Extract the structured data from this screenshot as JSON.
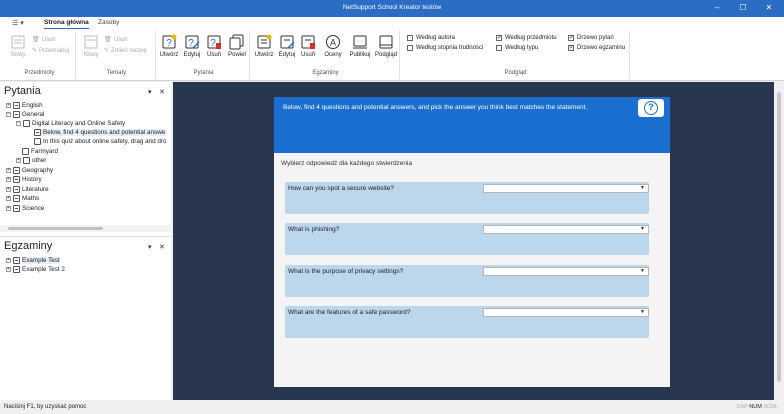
{
  "window": {
    "title": "NetSupport School Kreator testów"
  },
  "ribbon_tabs": {
    "qa": "☰ ▾",
    "main": "Strona główna",
    "res": "Zasoby"
  },
  "ribbon": {
    "przedmioty": {
      "label": "Przedmioty",
      "nowy": "Nowy",
      "usun": "Usuń",
      "przemianuj": "Przemianuj"
    },
    "tematy": {
      "label": "Tematy",
      "nowy": "Nowy",
      "usun": "Usuń",
      "zmien": "Zmień nazwę"
    },
    "pytania": {
      "label": "Pytania",
      "utworz": "Utwórz",
      "edytuj": "Edytuj",
      "usun": "Usuń",
      "powiel": "Powiel"
    },
    "egzaminy": {
      "label": "Egzaminy",
      "utworz": "Utwórz",
      "edytuj": "Edytuj",
      "usun": "Usuń",
      "oceny": "Oceny",
      "publikuj": "Publikuj",
      "podglad": "Podgląd"
    },
    "podglad": {
      "label": "Podgląd",
      "wg_autora": "Według autora",
      "wg_stopnia": "Według stopnia trudności",
      "wg_przedmiotu": "Według przedmiotu",
      "wg_typu": "Według typu",
      "drzewo_pytan": "Drzewo pytań",
      "drzewo_egz": "Drzewo egzaminu"
    }
  },
  "pytania_panel": {
    "title": "Pytania",
    "tree": {
      "english": "English",
      "general": "General",
      "digital": "Digital Literacy and Online Safety",
      "q1": "Below, find 4 questions and potential answe",
      "q2": "In this quiz about online safety, drag and dro",
      "farmyard": "Farmyard",
      "other": "other",
      "geography": "Geography",
      "history": "History",
      "literature": "Literature",
      "maths": "Maths",
      "science": "Science"
    }
  },
  "egzaminy_panel": {
    "title": "Egzaminy",
    "items": {
      "t1": "Example Test",
      "t2": "Example Test 2"
    }
  },
  "question": {
    "header": "Below, find 4 questions and potential answers, and pick the answer you think best matches the statement.",
    "instruction": "Wybierz odpowiedź dla każdego stwierdzenia",
    "items": [
      {
        "label": "How can you spot a secure website?",
        "value": ""
      },
      {
        "label": "What is phishing?",
        "value": ""
      },
      {
        "label": "What is the purpose of privacy settings?",
        "value": ""
      },
      {
        "label": "What are the features of a safe password?",
        "value": ""
      }
    ]
  },
  "status": {
    "help": "Naciśnij F1, by uzyskać pomoc",
    "cap": "CAP",
    "num": "NUM",
    "scrl": "SCRL"
  }
}
